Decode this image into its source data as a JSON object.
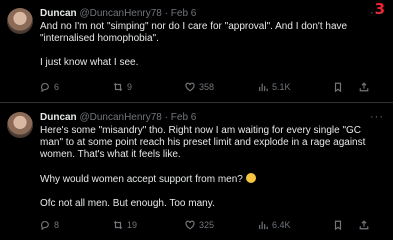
{
  "notification_mark": "3",
  "tweets": [
    {
      "name": "Duncan",
      "handle": "@DuncanHenry78",
      "sep": "·",
      "date": "Feb 6",
      "paragraphs": [
        "And no I'm not \"simping\" nor do I care for \"approval\". And I don't have \"internalised homophobia\".",
        "I just know what I see."
      ],
      "stats": {
        "replies": "6",
        "reposts": "9",
        "likes": "358",
        "views": "5.1K"
      }
    },
    {
      "name": "Duncan",
      "handle": "@DuncanHenry78",
      "sep": "·",
      "date": "Feb 6",
      "paragraphs": [
        "Here's some \"misandry\" tho. Right now I am waiting for every single \"GC man\" to at some point reach his preset limit and explode in a rage against women. That's what it feels like.",
        "Why would women accept support from men?",
        "Ofc not all men. But enough. Too many."
      ],
      "stats": {
        "replies": "8",
        "reposts": "19",
        "likes": "325",
        "views": "6.4K"
      }
    }
  ],
  "icons": {
    "more": "more-icon",
    "reply": "reply-icon",
    "repost": "repost-icon",
    "like": "heart-icon",
    "views": "views-icon",
    "bookmark": "bookmark-icon",
    "share": "share-icon",
    "emoji": "person-shrugging-emoji"
  },
  "colors": {
    "background": "#000000",
    "text": "#e7e9ea",
    "muted": "#71767b",
    "divider": "#2f3336",
    "notification": "#f4212e"
  }
}
